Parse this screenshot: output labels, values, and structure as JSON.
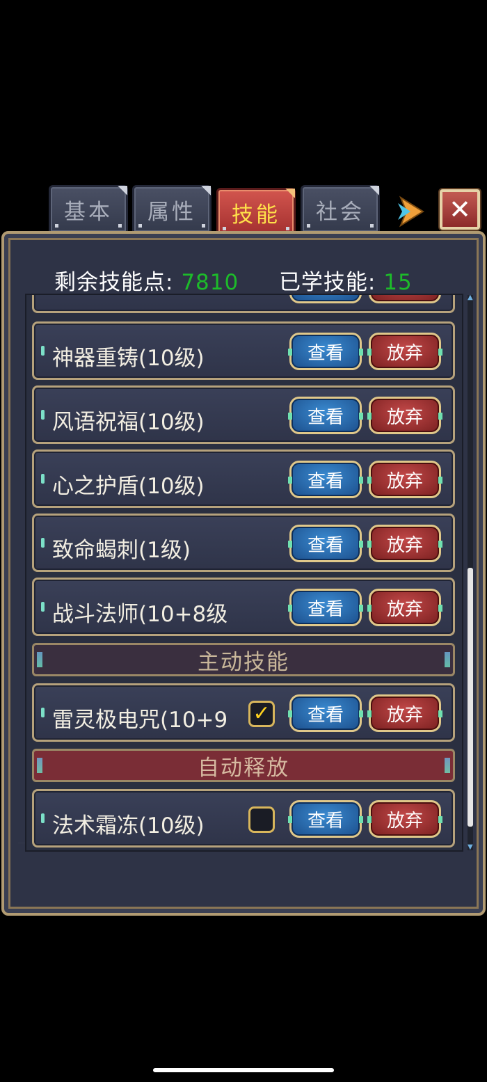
{
  "tabs": [
    {
      "label": "基本",
      "active": false
    },
    {
      "label": "属性",
      "active": false
    },
    {
      "label": "技能",
      "active": true
    },
    {
      "label": "社会",
      "active": false
    }
  ],
  "header": {
    "points_label": "剩余技能点:",
    "points_value": "7810",
    "learned_label": "已学技能:",
    "learned_value": "15"
  },
  "buttons": {
    "view": "查看",
    "drop": "放弃",
    "close": "✕"
  },
  "skills": [
    {
      "name": "神器重铸(10级)"
    },
    {
      "name": "风语祝福(10级)"
    },
    {
      "name": "心之护盾(10级)"
    },
    {
      "name": "致命蝎刺(1级)"
    },
    {
      "name": "战斗法师(10+8级"
    }
  ],
  "active_section": {
    "title": "主动技能",
    "skill": {
      "name": "雷灵极电咒(10+9",
      "checked": true
    }
  },
  "auto_section": {
    "title": "自动释放",
    "skill": {
      "name": "法术霜冻(10级)",
      "checked": false
    }
  },
  "colors": {
    "accent_green": "#1dbb2a",
    "active_tab_text": "#ffe14a",
    "panel_bg": "#2e3346"
  }
}
